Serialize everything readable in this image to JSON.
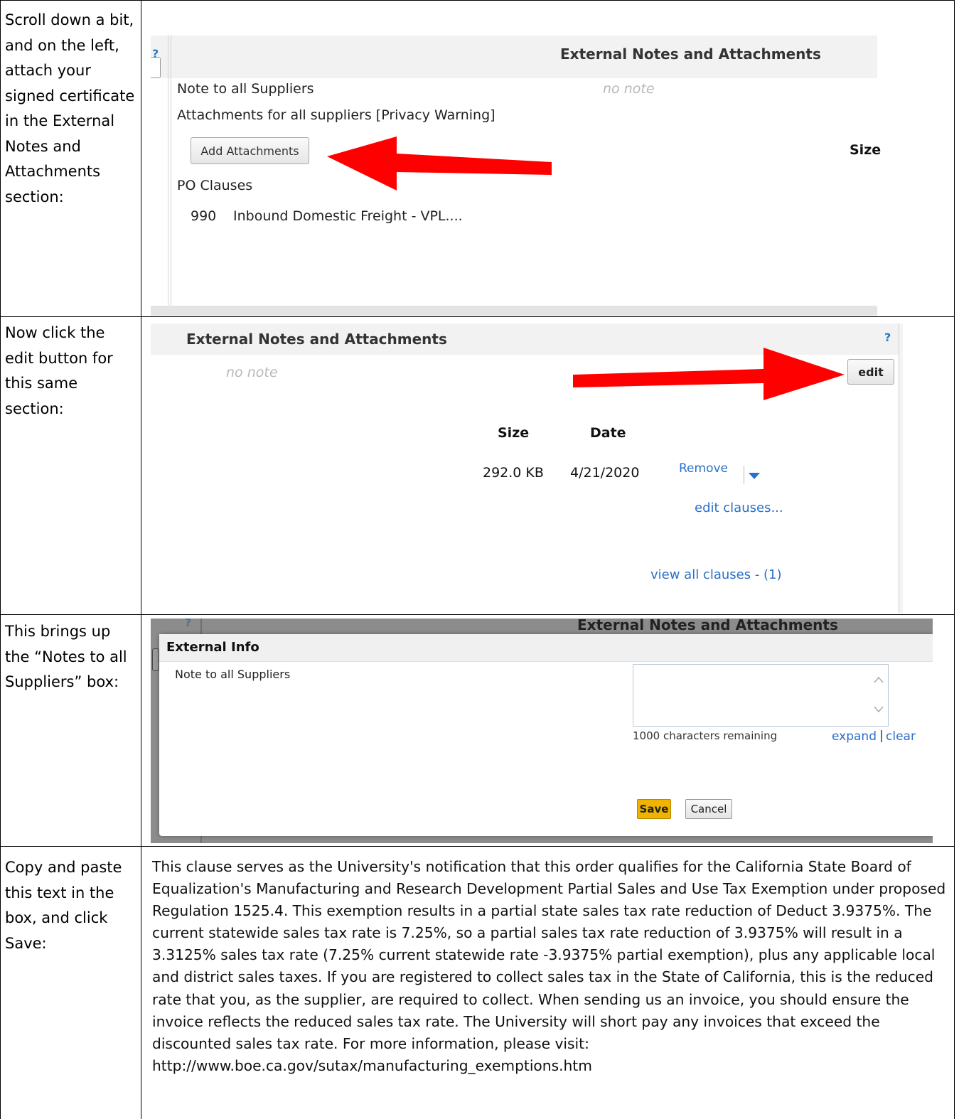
{
  "rows": [
    {
      "instruction": "Scroll down a bit, and on the left, attach your signed certificate in the External Notes and Attachments section:"
    },
    {
      "instruction": "Now click the edit button for this same section:"
    },
    {
      "instruction": "This brings up the “Notes to all Suppliers” box:"
    },
    {
      "instruction": "Copy and paste this text in the box, and click Save:"
    }
  ],
  "shot1": {
    "help": "?",
    "title": "External Notes and Attachments",
    "note_label": "Note to all Suppliers",
    "note_value": "no note",
    "attach_label": "Attachments for all suppliers [Privacy Warning]",
    "add_button": "Add Attachments",
    "size_header": "Size",
    "clauses_label": "PO Clauses",
    "clause_num": "990",
    "clause_name": "Inbound Domestic Freight - VPL...."
  },
  "shot2": {
    "title": "External Notes and Attachments",
    "help": "?",
    "note_value": "no note",
    "edit_button": "edit",
    "size_header": "Size",
    "date_header": "Date",
    "size_value": "292.0 KB",
    "date_value": "4/21/2020",
    "remove_link": "Remove",
    "edit_clauses": "edit clauses...",
    "view_all": "view all clauses - (1)"
  },
  "shot3": {
    "help": "?",
    "bg_title": "External Notes and Attachments",
    "dialog_title": "External Info",
    "note_label": "Note to all Suppliers",
    "remaining": "1000 characters remaining",
    "expand": "expand",
    "separator": "|",
    "clear": "clear",
    "save": "Save",
    "cancel": "Cancel"
  },
  "clause_text": "This clause serves as the University's notification that this order qualifies for the California State Board of Equalization's Manufacturing and Research Development Partial Sales and Use Tax Exemption under proposed Regulation 1525.4. This exemption results in a partial state sales tax rate reduction of Deduct 3.9375%. The current statewide sales tax rate is 7.25%, so a partial sales tax rate reduction of 3.9375% will result in a 3.3125% sales tax rate (7.25% current statewide rate -3.9375% partial exemption), plus any applicable local and district sales taxes. If you are registered to collect sales tax in the State of California, this is the reduced rate that you, as the supplier, are required to collect. When sending us an invoice, you should ensure the invoice reflects the reduced sales tax rate. The University will short pay any invoices that exceed the discounted sales tax rate. For more information, please visit: http://www.boe.ca.gov/sutax/manufacturing_exemptions.htm",
  "colors": {
    "arrow": "#ff0000",
    "link": "#2a6fc9",
    "save_button": "#f0b400"
  }
}
